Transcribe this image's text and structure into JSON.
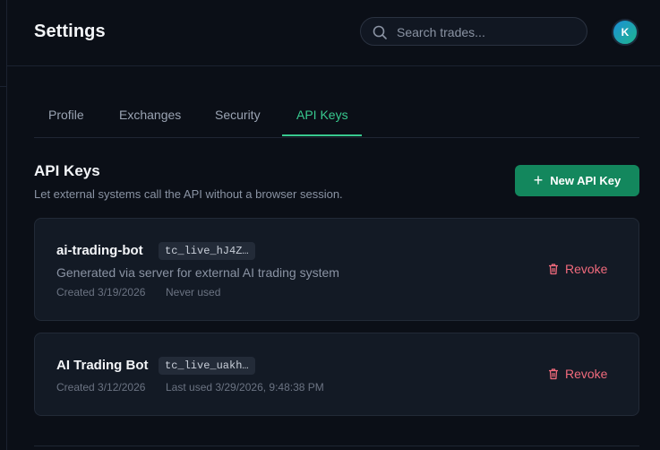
{
  "header": {
    "title": "Settings",
    "search_placeholder": "Search trades...",
    "avatar_initial": "K"
  },
  "tabs": [
    {
      "label": "Profile",
      "active": false
    },
    {
      "label": "Exchanges",
      "active": false
    },
    {
      "label": "Security",
      "active": false
    },
    {
      "label": "API Keys",
      "active": true
    }
  ],
  "section": {
    "title": "API Keys",
    "description": "Let external systems call the API without a browser session.",
    "new_key_label": "New API Key"
  },
  "keys": [
    {
      "name": "ai-trading-bot",
      "prefix": "tc_live_hJ4Z…",
      "description": "Generated via server for external AI trading system",
      "created": "Created 3/19/2026",
      "usage": "Never used",
      "revoke_label": "Revoke"
    },
    {
      "name": "AI Trading Bot",
      "prefix": "tc_live_uakh…",
      "created": "Created 3/12/2026",
      "usage": "Last used 3/29/2026, 9:48:38 PM",
      "revoke_label": "Revoke"
    }
  ],
  "colors": {
    "accent": "#38c98f",
    "primary_button": "#13875d",
    "danger": "#f06a7c",
    "background": "#0b0f17",
    "card": "#131a25"
  },
  "icons": {
    "search": "search-icon",
    "plus": "plus-icon",
    "revoke": "trash-icon"
  }
}
